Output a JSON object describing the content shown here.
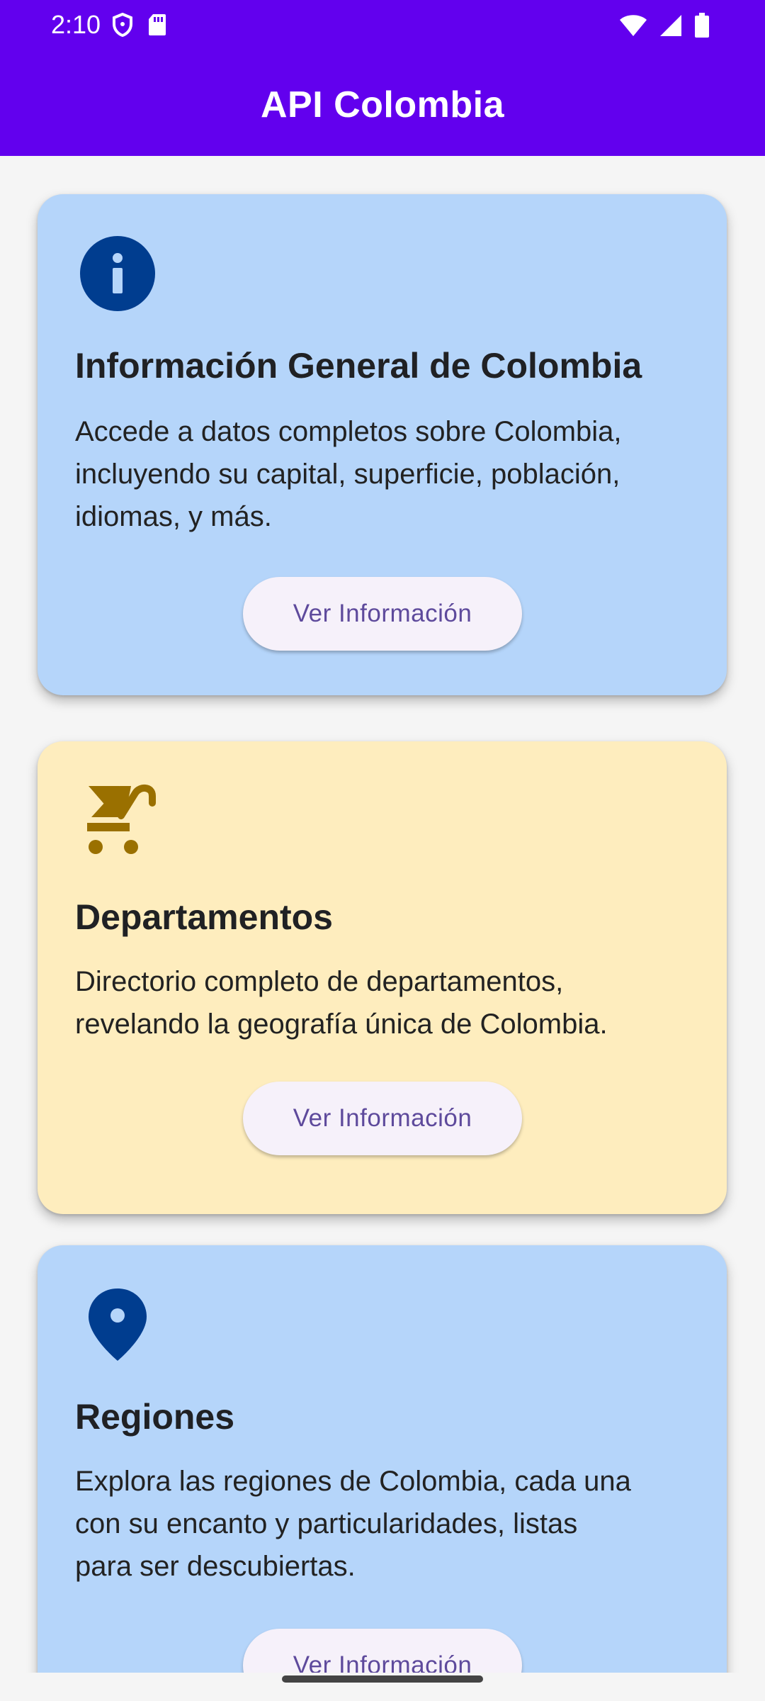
{
  "status_bar": {
    "time": "2:10",
    "left_icons": [
      "shield-icon",
      "sd-card-icon"
    ],
    "right_icons": [
      "wifi-icon",
      "signal-icon",
      "battery-icon"
    ]
  },
  "appbar": {
    "title": "API Colombia",
    "color": "#6200ee"
  },
  "cards": [
    {
      "icon": "info-icon",
      "title": "Información General de Colombia",
      "description_lines": [
        "Accede a datos completos sobre Colombia,",
        "incluyendo su capital, superficie, población,",
        "idiomas, y más."
      ],
      "button_label": "Ver Información",
      "background": "#b5d5fa",
      "icon_color": "#003d8f"
    },
    {
      "icon": "stroller-icon",
      "title": "Departamentos",
      "description_lines": [
        "Directorio completo de departamentos,",
        "revelando la geografía única de Colombia."
      ],
      "button_label": "Ver Información",
      "background": "#feedbe",
      "icon_color": "#9a7000"
    },
    {
      "icon": "location-pin-icon",
      "title": "Regiones",
      "description_lines": [
        "Explora las regiones de Colombia, cada una",
        "con su encanto y particularidades, listas",
        "para ser descubiertas."
      ],
      "button_label": "Ver Información",
      "background": "#b5d5fa",
      "icon_color": "#003d8f"
    }
  ]
}
